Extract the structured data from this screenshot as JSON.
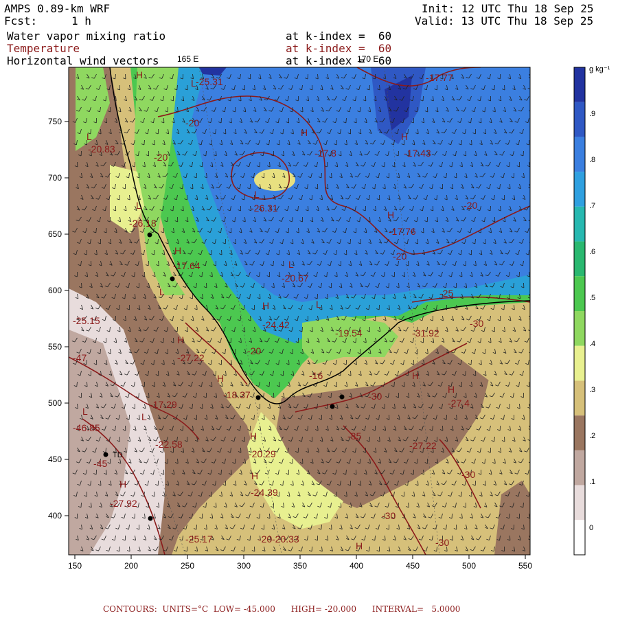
{
  "header": {
    "model": "AMPS 0.89-km WRF",
    "fcst_label": "Fcst:",
    "fcst_value": "1 h",
    "init": "Init: 12 UTC Thu 18 Sep 25",
    "valid": "Valid: 13 UTC Thu 18 Sep 25",
    "fields": [
      {
        "name": "Water vapor mixing ratio",
        "level": "at k-index =  60",
        "color": "#000000"
      },
      {
        "name": "Temperature",
        "level": "at k-index =  60",
        "color": "#8b1a1a"
      },
      {
        "name": "Horizontal wind vectors",
        "level": "at k-index =  60",
        "color": "#000000"
      }
    ]
  },
  "map": {
    "longitude_labels": [
      "165 E",
      "170 E"
    ],
    "x_ticks": [
      "150",
      "200",
      "250",
      "300",
      "350",
      "400",
      "450",
      "500",
      "550"
    ],
    "y_ticks": [
      "750",
      "700",
      "650",
      "600",
      "550",
      "500",
      "450",
      "400"
    ],
    "contour_labels": [
      "-25.31",
      "-17.77",
      "-20",
      "-20.83",
      "-20",
      "-17.8",
      "-17.43",
      "-26.31",
      "-20",
      "-26.18",
      "-17.76",
      "-17.64",
      "-20",
      "-20.67",
      "-25",
      "-25.15",
      "-24.42",
      "-19.54",
      "-31.92",
      "-30",
      "-47",
      "-27.22",
      "-20",
      "-16",
      "-27.4",
      "-17.29",
      "-18.37",
      "-30",
      "-46.85",
      "-22.58",
      "-20.29",
      "-27.22",
      "-85",
      "-45",
      "-27.92",
      "-24.39",
      "-30",
      "-20",
      "-25.17",
      "-20.33",
      "-30",
      "-30"
    ],
    "high_low_marks": [
      "H",
      "L",
      "H",
      "L",
      "H",
      "L",
      "L",
      "H",
      "H",
      "L",
      "L",
      "H",
      "L",
      "H",
      "H",
      "H",
      "H",
      "L",
      "L",
      "H",
      "H",
      "H",
      "H"
    ],
    "station_label": "TD"
  },
  "colorbar": {
    "units": "g kg⁻¹",
    "labels": [
      ".9",
      ".8",
      ".7",
      ".6",
      ".5",
      ".4",
      ".3",
      ".2",
      ".1",
      "0"
    ],
    "colors": [
      "#2233a0",
      "#2f58c4",
      "#3b7fe0",
      "#2fa0e0",
      "#27b8b0",
      "#2ab870",
      "#4cc850",
      "#8fd860",
      "#e8f090",
      "#d6c07a",
      "#9a7660",
      "#c0a8a0",
      "#e8dcdc",
      "#ffffff"
    ]
  },
  "footer": {
    "contours": "CONTOURS:  UNITS=°C  LOW= -45.000      HIGH= -20.000      INTERVAL=   5.0000"
  }
}
